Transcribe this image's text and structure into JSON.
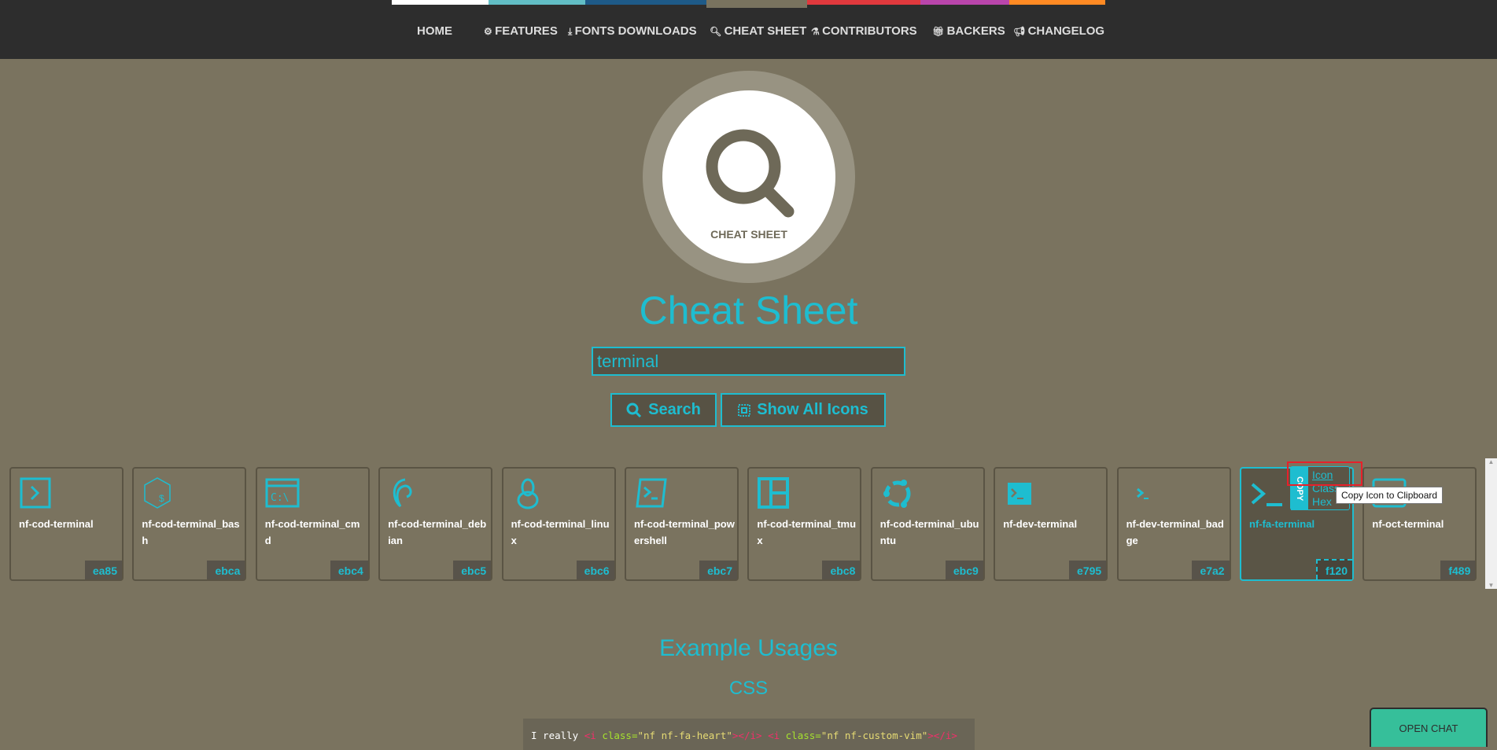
{
  "nav": {
    "strip_colors": [
      "#ffffff",
      "#62bec5",
      "#1e5a88",
      "#79735f",
      "#e0393d",
      "#b945ab",
      "#ff8a23"
    ],
    "items": [
      {
        "label": "HOME",
        "icon": ""
      },
      {
        "label": "FEATURES",
        "icon": "cogs-icon"
      },
      {
        "label": "FONTS DOWNLOADS",
        "icon": "download-icon"
      },
      {
        "label": "CHEAT SHEET",
        "icon": "search-icon"
      },
      {
        "label": "CONTRIBUTORS",
        "icon": "flask-icon"
      },
      {
        "label": "BACKERS",
        "icon": "gift-icon"
      },
      {
        "label": "CHANGELOG",
        "icon": "bullhorn-icon"
      }
    ],
    "active": "CHEAT SHEET"
  },
  "hero": {
    "label": "CHEAT SHEET",
    "title": "Cheat Sheet"
  },
  "search": {
    "value": "terminal",
    "search_label": "Search",
    "show_all_label": "Show All Icons"
  },
  "cards": [
    {
      "name": "nf-cod-terminal",
      "hex": "ea85"
    },
    {
      "name": "nf-cod-terminal_bash",
      "hex": "ebca"
    },
    {
      "name": "nf-cod-terminal_cmd",
      "hex": "ebc4"
    },
    {
      "name": "nf-cod-terminal_debian",
      "hex": "ebc5"
    },
    {
      "name": "nf-cod-terminal_linux",
      "hex": "ebc6"
    },
    {
      "name": "nf-cod-terminal_powershell",
      "hex": "ebc7"
    },
    {
      "name": "nf-cod-terminal_tmux",
      "hex": "ebc8"
    },
    {
      "name": "nf-cod-terminal_ubuntu",
      "hex": "ebc9"
    },
    {
      "name": "nf-dev-terminal",
      "hex": "e795"
    },
    {
      "name": "nf-dev-terminal_badge",
      "hex": "e7a2"
    },
    {
      "name": "nf-fa-terminal",
      "hex": "f120"
    },
    {
      "name": "nf-oct-terminal",
      "hex": "f489"
    }
  ],
  "copy_menu": {
    "tab": "COPY",
    "options": [
      "Icon",
      "Class",
      "Hex"
    ],
    "tooltip": "Copy Icon to Clipboard"
  },
  "examples": {
    "title": "Example Usages",
    "css": "CSS",
    "code": {
      "text": "I really ",
      "tag1": "<i ",
      "attr": "class=",
      "val1": "\"nf nf-fa-heart\"",
      "close": "></i>",
      "val2": "\"nf nf-custom-vim\""
    }
  },
  "chat": {
    "label": "OPEN CHAT"
  },
  "colors": {
    "accent": "#1ebdd0",
    "background": "#7a735f",
    "chat": "#36bf9a"
  }
}
